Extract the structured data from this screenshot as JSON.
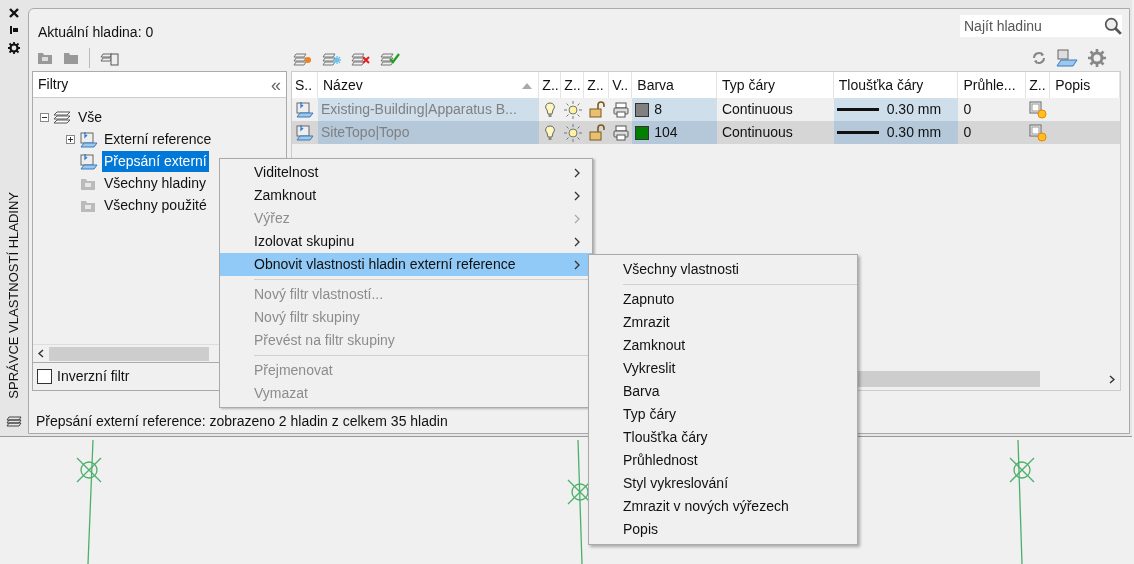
{
  "side_title": "SPRÁVCE VLASTNOSTÍ HLADINY",
  "current_layer": "Aktuální hladina: 0",
  "search": {
    "placeholder": "Najít hladinu"
  },
  "filters": {
    "title": "Filtry",
    "collapse": "«",
    "tree": [
      {
        "label": "Vše",
        "kind": "all",
        "expanded": true,
        "selected": false,
        "children": [
          {
            "label": "Externí reference",
            "kind": "xref",
            "expanded": false,
            "selected": false
          },
          {
            "label": "Přepsání externí",
            "kind": "xref",
            "selected": true
          },
          {
            "label": "Všechny hladiny",
            "kind": "filter",
            "selected": false
          },
          {
            "label": "Všechny použité",
            "kind": "filter",
            "selected": false
          }
        ]
      }
    ],
    "inverse_filter": {
      "label": "Inverzní filtr",
      "checked": false
    }
  },
  "table": {
    "columns": [
      "S..",
      "Název",
      "Z..",
      "Z..",
      "Z..",
      "V..",
      "Barva",
      "Typ čáry",
      "Tloušťka čáry",
      "Průhle...",
      "Z..",
      "Popis"
    ],
    "rows": [
      {
        "name": "Existing-Building|Apparatus B...",
        "selected": false,
        "color": "#808080",
        "color_label": "8",
        "linetype": "Continuous",
        "lineweight": "0.30 mm",
        "transparency": "0"
      },
      {
        "name": "SiteTopo|Topo",
        "selected": true,
        "color": "#007f00",
        "color_label": "104",
        "linetype": "Continuous",
        "lineweight": "0.30 mm",
        "transparency": "0"
      }
    ]
  },
  "status_bar": "Přepsání externí reference: zobrazeno 2 hladin z celkem 35 hladin",
  "context_menu": [
    {
      "kind": "item",
      "label": "Viditelnost",
      "submenu": true,
      "disabled": false,
      "selected": false
    },
    {
      "kind": "item",
      "label": "Zamknout",
      "submenu": true,
      "disabled": false,
      "selected": false
    },
    {
      "kind": "item",
      "label": "Výřez",
      "submenu": true,
      "disabled": true,
      "selected": false
    },
    {
      "kind": "item",
      "label": "Izolovat skupinu",
      "submenu": true,
      "disabled": false,
      "selected": false
    },
    {
      "kind": "item",
      "label": "Obnovit vlastnosti hladin externí reference",
      "submenu": true,
      "disabled": false,
      "selected": true
    },
    {
      "kind": "separator"
    },
    {
      "kind": "item",
      "label": "Nový filtr vlastností...",
      "submenu": false,
      "disabled": true,
      "selected": false
    },
    {
      "kind": "item",
      "label": "Nový filtr skupiny",
      "submenu": false,
      "disabled": true,
      "selected": false
    },
    {
      "kind": "item",
      "label": "Převést na filtr skupiny",
      "submenu": false,
      "disabled": true,
      "selected": false
    },
    {
      "kind": "separator"
    },
    {
      "kind": "item",
      "label": "Přejmenovat",
      "submenu": false,
      "disabled": true,
      "selected": false
    },
    {
      "kind": "item",
      "label": "Vymazat",
      "submenu": false,
      "disabled": true,
      "selected": false
    }
  ],
  "submenu": [
    {
      "kind": "item",
      "label": "Všechny vlastnosti"
    },
    {
      "kind": "separator"
    },
    {
      "kind": "item",
      "label": "Zapnuto"
    },
    {
      "kind": "item",
      "label": "Zmrazit"
    },
    {
      "kind": "item",
      "label": "Zamknout"
    },
    {
      "kind": "item",
      "label": "Vykreslit"
    },
    {
      "kind": "item",
      "label": "Barva"
    },
    {
      "kind": "item",
      "label": "Typ čáry"
    },
    {
      "kind": "item",
      "label": "Tloušťka čáry"
    },
    {
      "kind": "item",
      "label": "Průhlednost"
    },
    {
      "kind": "item",
      "label": "Styl vykreslování"
    },
    {
      "kind": "item",
      "label": "Zmrazit v nových výřezech"
    },
    {
      "kind": "item",
      "label": "Popis"
    }
  ]
}
